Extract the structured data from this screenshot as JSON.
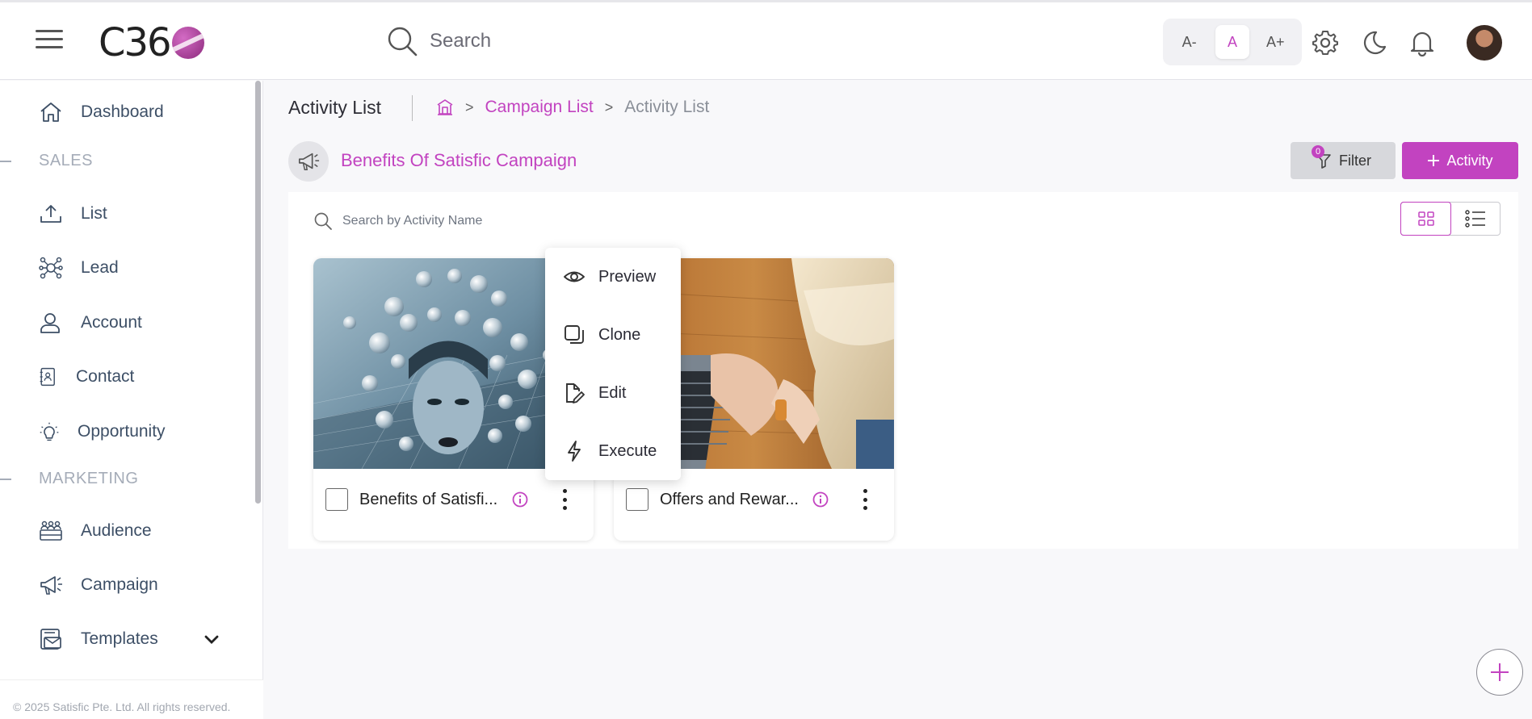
{
  "app": {
    "logo_text": "C36"
  },
  "header": {
    "search_placeholder": "Search",
    "font_controls": [
      "A-",
      "A",
      "A+"
    ],
    "icons": [
      "hamburger-icon",
      "search-icon",
      "gear-icon",
      "moon-icon",
      "bell-icon",
      "avatar"
    ]
  },
  "sidebar": {
    "items": [
      {
        "label": "Dashboard",
        "icon": "home-icon"
      },
      {
        "label": "List",
        "icon": "upload-icon"
      },
      {
        "label": "Lead",
        "icon": "network-icon"
      },
      {
        "label": "Account",
        "icon": "user-icon"
      },
      {
        "label": "Contact",
        "icon": "contact-book-icon"
      },
      {
        "label": "Opportunity",
        "icon": "lightbulb-icon"
      },
      {
        "label": "Audience",
        "icon": "audience-icon"
      },
      {
        "label": "Campaign",
        "icon": "megaphone-icon"
      },
      {
        "label": "Templates",
        "icon": "template-icon"
      }
    ],
    "sections": [
      "SALES",
      "MARKETING"
    ],
    "footer": "© 2025 Satisfic Pte. Ltd. All rights reserved."
  },
  "page": {
    "title": "Activity List",
    "breadcrumb": [
      "Campaign List",
      "Activity List"
    ],
    "campaign_name": "Benefits Of Satisfic Campaign",
    "filter_label": "Filter",
    "filter_count": "0",
    "add_label": "Activity",
    "search_placeholder": "Search by Activity Name"
  },
  "cards": [
    {
      "name": "Benefits of Satisfi...",
      "image": "woman-with-social-media-icons"
    },
    {
      "name": "Offers and Rewar...",
      "image": "woman-typing-on-laptop"
    }
  ],
  "context_menu": {
    "items": [
      {
        "label": "Preview",
        "icon": "eye-icon"
      },
      {
        "label": "Clone",
        "icon": "copy-icon"
      },
      {
        "label": "Edit",
        "icon": "edit-icon"
      },
      {
        "label": "Execute",
        "icon": "lightning-icon"
      }
    ]
  },
  "colors": {
    "accent": "#c243c0",
    "nav_text": "#3d4f66"
  }
}
